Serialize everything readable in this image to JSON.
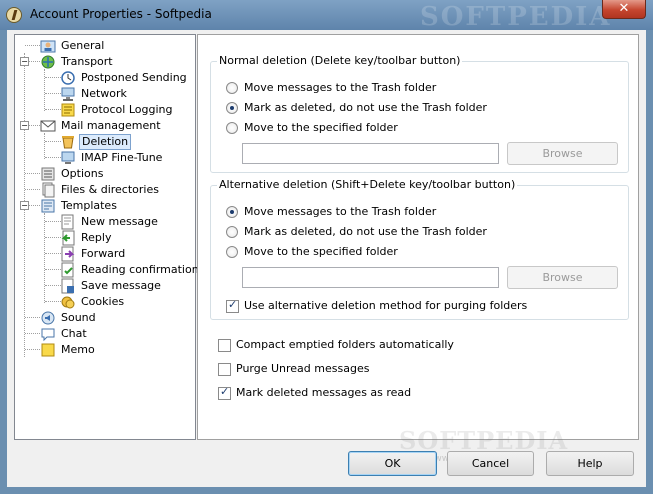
{
  "window": {
    "title": "Account Properties - Softpedia",
    "watermark": "SOFTPEDIA",
    "close_glyph": "✕"
  },
  "tree": {
    "items": [
      {
        "label": "General",
        "icon": "user-general-icon"
      },
      {
        "label": "Transport",
        "icon": "transport-icon"
      },
      {
        "label": "Postponed Sending",
        "icon": "clock-icon"
      },
      {
        "label": "Network",
        "icon": "network-icon"
      },
      {
        "label": "Protocol Logging",
        "icon": "log-icon"
      },
      {
        "label": "Mail management",
        "icon": "mail-icon"
      },
      {
        "label": "Deletion",
        "icon": "trash-icon"
      },
      {
        "label": "IMAP Fine-Tune",
        "icon": "imap-icon"
      },
      {
        "label": "Options",
        "icon": "options-icon"
      },
      {
        "label": "Files & directories",
        "icon": "files-icon"
      },
      {
        "label": "Templates",
        "icon": "templates-icon"
      },
      {
        "label": "New message",
        "icon": "new-message-icon"
      },
      {
        "label": "Reply",
        "icon": "reply-icon"
      },
      {
        "label": "Forward",
        "icon": "forward-icon"
      },
      {
        "label": "Reading confirmation",
        "icon": "confirmation-icon"
      },
      {
        "label": "Save message",
        "icon": "save-message-icon"
      },
      {
        "label": "Cookies",
        "icon": "cookies-icon"
      },
      {
        "label": "Sound",
        "icon": "sound-icon"
      },
      {
        "label": "Chat",
        "icon": "chat-icon"
      },
      {
        "label": "Memo",
        "icon": "memo-icon"
      }
    ],
    "selected": "Deletion"
  },
  "normal_deletion": {
    "legend": "Normal deletion (Delete key/toolbar button)",
    "options": [
      "Move messages to the Trash folder",
      "Mark as deleted, do not use the Trash folder",
      "Move to the specified folder"
    ],
    "selected": "Mark as deleted, do not use the Trash folder",
    "folder_value": "",
    "browse_label": "Browse"
  },
  "alternative_deletion": {
    "legend": "Alternative deletion (Shift+Delete key/toolbar button)",
    "options": [
      "Move messages to the Trash folder",
      "Mark as deleted, do not use the Trash folder",
      "Move to the specified folder"
    ],
    "selected": "Move messages to the Trash folder",
    "folder_value": "",
    "browse_label": "Browse",
    "purge_checkbox": {
      "label": "Use alternative deletion method for purging folders",
      "checked": true
    }
  },
  "checkboxes": [
    {
      "label": "Compact emptied folders automatically",
      "checked": false
    },
    {
      "label": "Purge Unread messages",
      "checked": false
    },
    {
      "label": "Mark deleted messages as read",
      "checked": true
    }
  ],
  "buttons": {
    "ok": "OK",
    "cancel": "Cancel",
    "help": "Help"
  },
  "footer_watermark": {
    "brand": "SOFTPEDIA",
    "url": "www.softpedia.com"
  }
}
